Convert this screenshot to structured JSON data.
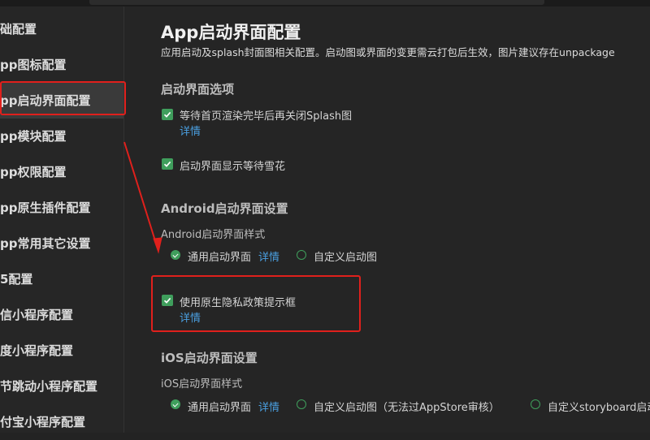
{
  "sidebar": {
    "items": [
      {
        "label": "础配置"
      },
      {
        "label": "pp图标配置"
      },
      {
        "label": "pp启动界面配置"
      },
      {
        "label": "pp模块配置"
      },
      {
        "label": "pp权限配置"
      },
      {
        "label": "pp原生插件配置"
      },
      {
        "label": "pp常用其它设置"
      },
      {
        "label": "5配置"
      },
      {
        "label": "信小程序配置"
      },
      {
        "label": "度小程序配置"
      },
      {
        "label": "节跳动小程序配置"
      },
      {
        "label": "付宝小程序配置"
      }
    ],
    "active_index": 2
  },
  "main": {
    "title": "App启动界面配置",
    "description": "应用启动及splash封面图相关配置。启动图或界面的变更需云打包后生效，图片建议存在unpackage",
    "splash_section": {
      "title": "启动界面选项",
      "option1": {
        "label": "等待首页渲染完毕后再关闭Splash图",
        "checked": true,
        "link": "详情"
      },
      "option2": {
        "label": "启动界面显示等待雪花",
        "checked": true
      }
    },
    "android_section": {
      "title": "Android启动界面设置",
      "style_label": "Android启动界面样式",
      "radio_default": {
        "label": "通用启动界面",
        "selected": true,
        "link": "详情"
      },
      "radio_custom": {
        "label": "自定义启动图",
        "selected": false
      },
      "privacy": {
        "label": "使用原生隐私政策提示框",
        "checked": true,
        "link": "详情"
      }
    },
    "ios_section": {
      "title": "iOS启动界面设置",
      "style_label": "iOS启动界面样式",
      "radio_default": {
        "label": "通用启动界面",
        "selected": true,
        "link": "详情"
      },
      "radio_custom": {
        "label": "自定义启动图（无法过AppStore审核）",
        "selected": false
      },
      "radio_storyboard": {
        "label": "自定义storyboard启动",
        "selected": false
      }
    }
  },
  "colors": {
    "background": "#252525",
    "sidebar": "#262626",
    "accent_green": "#3f9e5c",
    "link_blue": "#4a9fe0",
    "highlight_red": "#e0201c"
  }
}
